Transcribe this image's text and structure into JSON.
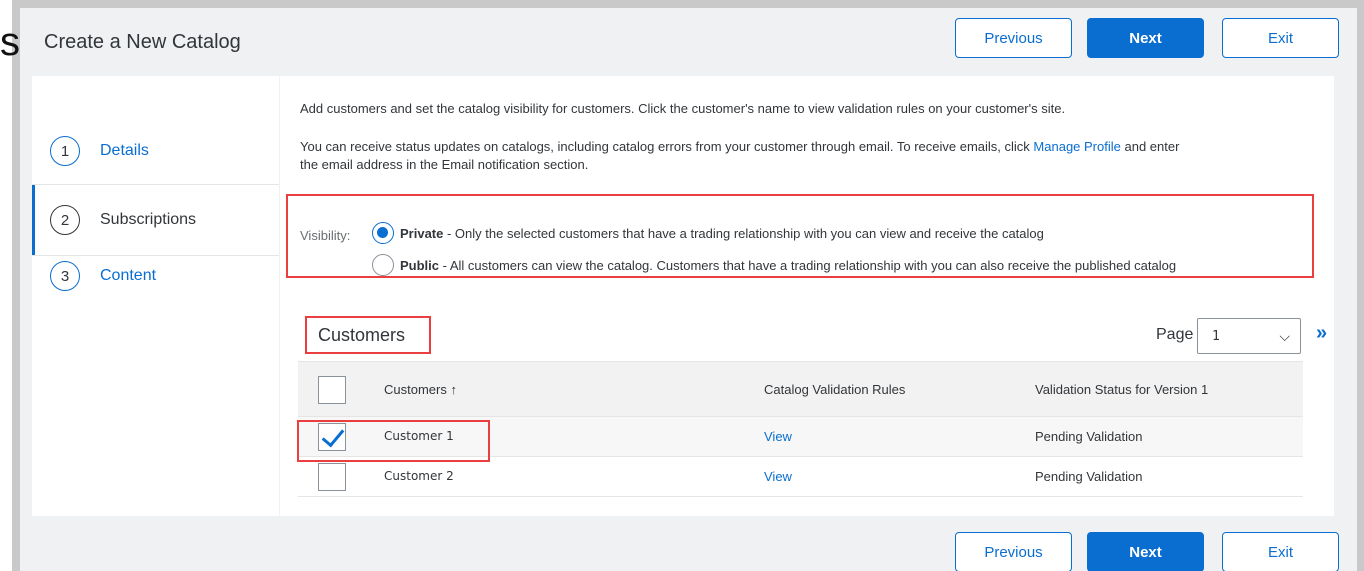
{
  "header": {
    "cut_char": "s",
    "title": "Create a New Catalog",
    "previous_label": "Previous",
    "next_label": "Next",
    "exit_label": "Exit"
  },
  "steps": [
    {
      "number": "1",
      "label": "Details"
    },
    {
      "number": "2",
      "label": "Subscriptions"
    },
    {
      "number": "3",
      "label": "Content"
    }
  ],
  "description": {
    "line1": "Add customers and set the catalog visibility for customers. Click the customer's name to view validation rules on your customer's site.",
    "line2_prefix": "You can receive status updates on catalogs, including catalog errors from your customer through email. To receive emails, click ",
    "line2_link": "Manage Profile",
    "line2_suffix": " and enter",
    "line3": "the email address in the Email notification section."
  },
  "visibility": {
    "label": "Visibility:",
    "private_title": "Private",
    "private_text": " - Only the selected customers that have a trading relationship with you can view and receive the catalog",
    "public_title": "Public",
    "public_text": " - All customers can view the catalog. Customers that have a trading relationship with you can also receive the published catalog",
    "selected": "Private"
  },
  "customers": {
    "heading": "Customers",
    "page_label": "Page",
    "page_value": "1",
    "page_next_icon": "»",
    "select_arrow_icon": "⌵",
    "columns": [
      "Customers ↑",
      "Catalog Validation Rules",
      "Validation Status for Version 1"
    ],
    "rows": [
      {
        "name": "Customer 1",
        "rules": "View",
        "status": "Pending Validation",
        "checked": true
      },
      {
        "name": "Customer 2",
        "rules": "View",
        "status": "Pending Validation",
        "checked": false
      }
    ]
  },
  "colors": {
    "accent": "#0a6ed1",
    "highlight": "#e9403f"
  }
}
